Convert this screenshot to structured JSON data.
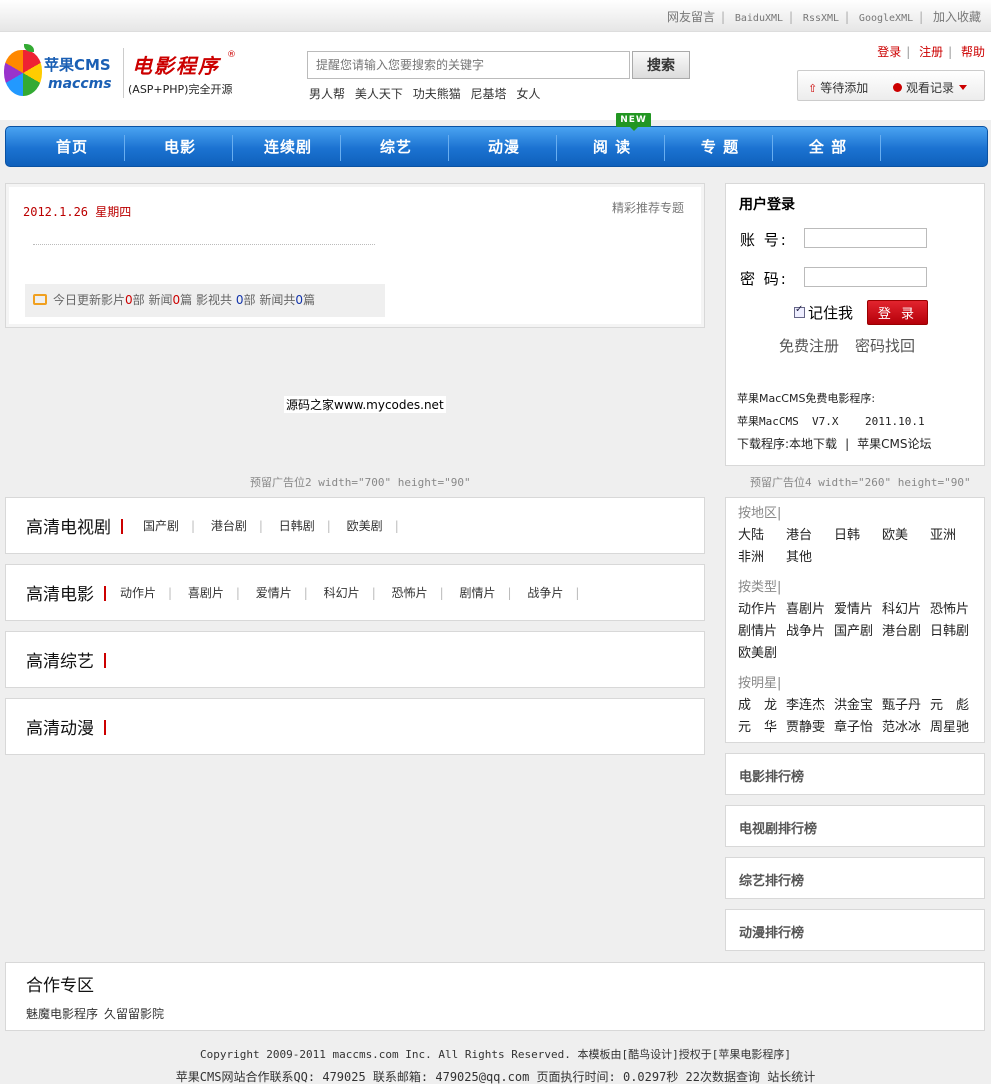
{
  "top_links": [
    "网友留言",
    "BaiduXML",
    "RssXML",
    "GoogleXML",
    "加入收藏"
  ],
  "logo": {
    "cms_text": "苹果CMS",
    "mac_text": "maccms",
    "brand_text": "电影程序",
    "reg_mark": "®",
    "tagline": "(ASP+PHP)完全开源"
  },
  "search": {
    "placeholder": "提醒您请输入您要搜索的关键字",
    "button_label": "搜索"
  },
  "hot_words": [
    "男人帮",
    "美人天下",
    "功夫熊猫",
    "尼基塔",
    "女人"
  ],
  "user_links": [
    "登录",
    "注册",
    "帮助"
  ],
  "record_bar": {
    "pending_label": "等待添加",
    "history_label": "观看记录"
  },
  "nav": {
    "items": [
      "首页",
      "电影",
      "连续剧",
      "综艺",
      "动漫",
      "阅 读",
      "专 题",
      "全 部"
    ],
    "new_badge": "NEW"
  },
  "news": {
    "date": "2012.1.26",
    "weekday": "星期四",
    "special_link": "精彩推荐专题",
    "today": {
      "label1": "今日更新影片",
      "count1": "0",
      "unit1": "部",
      "label2": "新闻",
      "count2": "0",
      "unit2": "篇",
      "label3": "影视共",
      "count3": "0",
      "unit3": "部",
      "label4": "新闻共",
      "count4": "0",
      "unit4": "篇"
    }
  },
  "ad": {
    "watermark": "源码之家www.mycodes.net",
    "slot2": "预留广告位2 width=\"700\" height=\"90\"",
    "slot4": "预留广告位4 width=\"260\" height=\"90\""
  },
  "login": {
    "title": "用户登录",
    "account_label": "账  号:",
    "password_label": "密  码:",
    "remember_label": "记住我",
    "login_button": "登 录",
    "register_link": "免费注册",
    "recover_link": "密码找回",
    "info_line1": "苹果MacCMS免费电影程序:",
    "info_line2": "苹果MacCMS  V7.X    2011.10.1",
    "download_label": "下载程序:",
    "download_local": "本地下载",
    "forum_link": "苹果CMS论坛"
  },
  "categories": [
    {
      "title": "高清电视剧",
      "links": [
        "国产剧",
        "港台剧",
        "日韩剧",
        "欧美剧"
      ]
    },
    {
      "title": "高清电影",
      "links": [
        "动作片",
        "喜剧片",
        "爱情片",
        "科幻片",
        "恐怖片",
        "剧情片",
        "战争片"
      ]
    },
    {
      "title": "高清综艺",
      "links": []
    },
    {
      "title": "高清动漫",
      "links": []
    }
  ],
  "filters": {
    "region_title": "按地区|",
    "regions": [
      "大陆",
      "港台",
      "日韩",
      "欧美",
      "亚洲",
      "非洲",
      "其他"
    ],
    "type_title": "按类型|",
    "types": [
      "动作片",
      "喜剧片",
      "爱情片",
      "科幻片",
      "恐怖片",
      "剧情片",
      "战争片",
      "国产剧",
      "港台剧",
      "日韩剧",
      "欧美剧"
    ],
    "star_title": "按明星|",
    "stars": [
      "成　龙",
      "李连杰",
      "洪金宝",
      "甄子丹",
      "元　彪",
      "元　华",
      "贾静雯",
      "章子怡",
      "范冰冰",
      "周星驰"
    ]
  },
  "rankings": [
    "电影排行榜",
    "电视剧排行榜",
    "综艺排行榜",
    "动漫排行榜"
  ],
  "partners": {
    "title": "合作专区",
    "links": [
      "魅魔电影程序",
      "久留留影院"
    ]
  },
  "footer": {
    "line1": "Copyright 2009-2011 maccms.com Inc. All Rights Reserved. 本模板由[酷鸟设计]授权于[苹果电影程序]",
    "line2": "苹果CMS网站合作联系QQ: 479025 联系邮箱: 479025@qq.com 页面执行时间: 0.0297秒 22次数据查询 站长统计"
  },
  "colors": {
    "nav_blue": "#1b72d1",
    "accent_red": "#c00",
    "new_green": "#229622"
  }
}
